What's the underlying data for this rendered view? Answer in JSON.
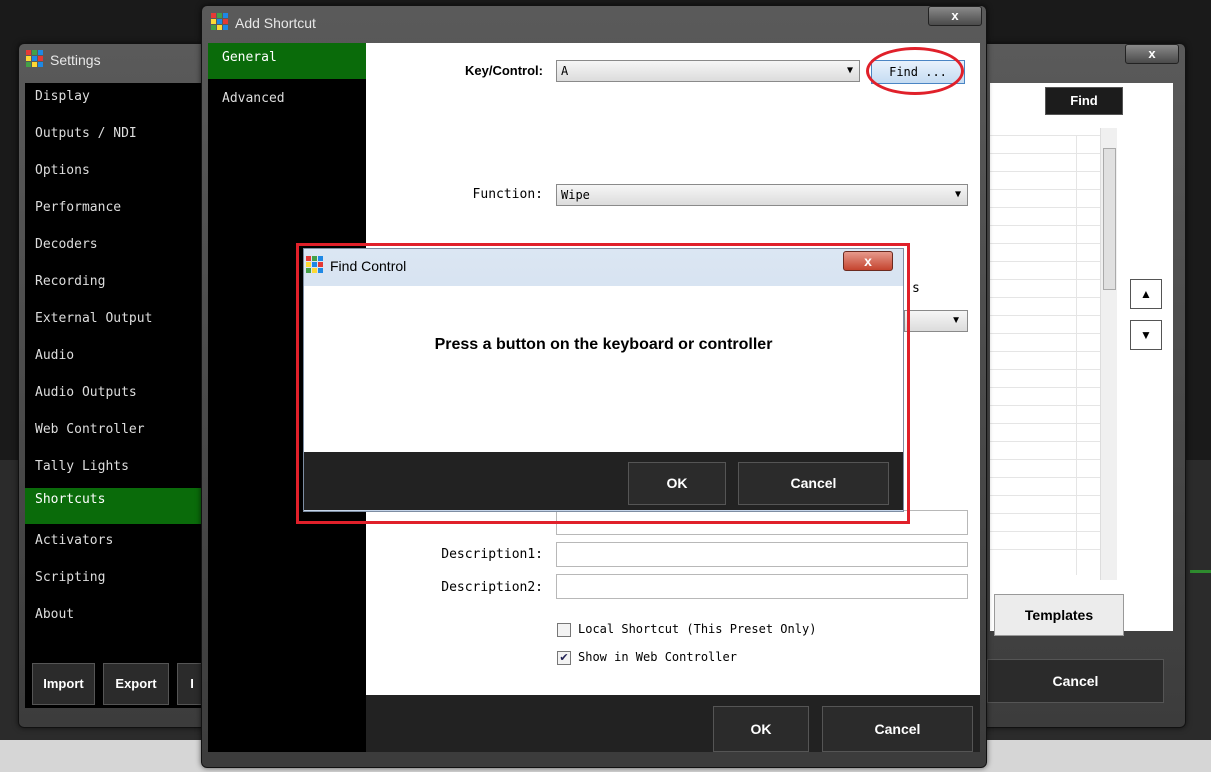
{
  "settings": {
    "title": "Settings",
    "close": "x",
    "nav": [
      "Display",
      "Outputs / NDI",
      "Options",
      "Performance",
      "Decoders",
      "Recording",
      "External Output",
      "Audio",
      "Audio Outputs",
      "Web Controller",
      "Tally Lights",
      "Shortcuts",
      "Activators",
      "Scripting",
      "About"
    ],
    "active_index": 11,
    "buttons": {
      "import": "Import",
      "export": "Export",
      "partial": "I"
    },
    "right": {
      "find": "Find",
      "templates": "Templates",
      "cancel": "Cancel",
      "up": "▲",
      "down": "▼"
    }
  },
  "add_shortcut": {
    "title": "Add Shortcut",
    "close": "x",
    "tabs": [
      "General",
      "Advanced"
    ],
    "key_label": "Key/Control:",
    "key_value": "A",
    "find_button": "Find ...",
    "function_label": "Function:",
    "function_value": "Wipe",
    "partial_label": "s",
    "description1_label": "Description1:",
    "description2_label": "Description2:",
    "local_shortcut_label": "Local Shortcut (This Preset Only)",
    "local_shortcut_checked": false,
    "show_web_label": "Show in Web Controller",
    "show_web_checked": true,
    "ok": "OK",
    "cancel": "Cancel"
  },
  "find_control": {
    "title": "Find Control",
    "close": "x",
    "message": "Press a button on the keyboard or controller",
    "ok": "OK",
    "cancel": "Cancel"
  },
  "colors": {
    "accent_green": "#0a6b0a",
    "highlight_red": "#e0202a"
  }
}
